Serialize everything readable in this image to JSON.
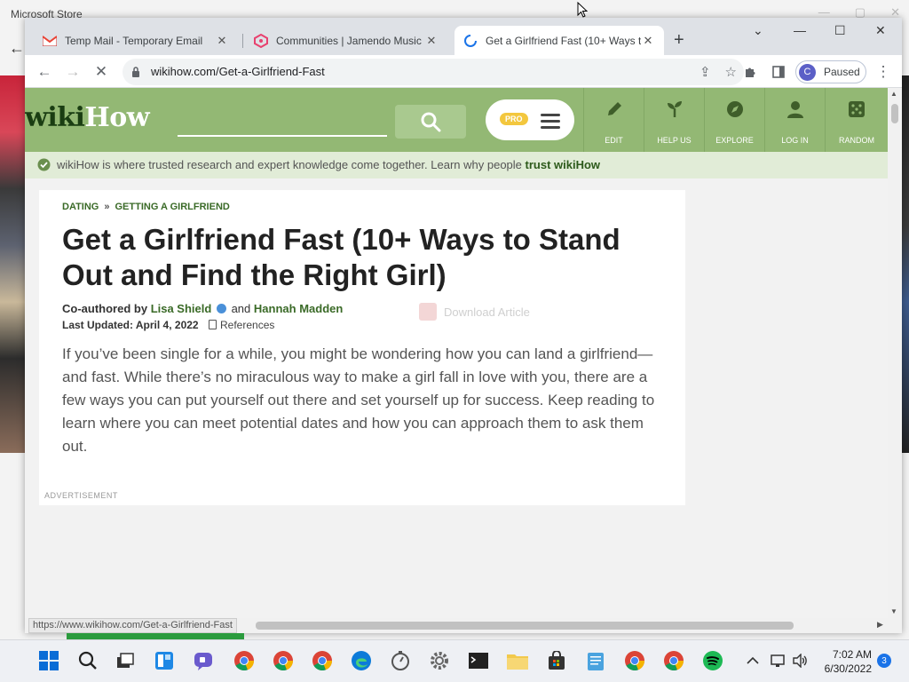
{
  "background_window": {
    "title": "Microsoft Store"
  },
  "tabs": [
    {
      "title": "Temp Mail - Temporary Email",
      "icon": "gmail-icon"
    },
    {
      "title": "Communities | Jamendo Music | F",
      "icon": "jamendo-icon"
    },
    {
      "title": "Get a Girlfriend Fast (10+ Ways t",
      "icon": "loading-spinner-icon"
    }
  ],
  "toolbar": {
    "url": "wikihow.com/Get-a-Girlfriend-Fast",
    "profile_initial": "C",
    "profile_label": "Paused"
  },
  "wikihow": {
    "logo_part1": "wiki",
    "logo_part2": "How",
    "pro_badge": "PRO",
    "nav": [
      {
        "label": "EDIT",
        "icon": "pencil-icon"
      },
      {
        "label": "HELP US",
        "icon": "sprout-icon"
      },
      {
        "label": "EXPLORE",
        "icon": "compass-icon"
      },
      {
        "label": "LOG IN",
        "icon": "user-icon"
      },
      {
        "label": "RANDOM",
        "icon": "dice-icon"
      }
    ],
    "trust_text": "wikiHow is where trusted research and expert knowledge come together. Learn why people ",
    "trust_link": "trust wikiHow"
  },
  "article": {
    "breadcrumb": [
      "DATING",
      "GETTING A GIRLFRIEND"
    ],
    "breadcrumb_sep": "»",
    "title": "Get a Girlfriend Fast (10+ Ways to Stand Out and Find the Right Girl)",
    "coauthored_label": "Co-authored by",
    "author1": "Lisa Shield",
    "and": "and",
    "author2": "Hannah Madden",
    "last_updated": "Last Updated: April 4, 2022",
    "references": "References",
    "download": "Download Article",
    "intro": "If you’ve been single for a while, you might be wondering how you can land a girlfriend—and fast. While there’s no miraculous way to make a girl fall in love with you, there are a few ways you can put yourself out there and set yourself up for success. Keep reading to learn where you can meet potential dates and how you can approach them to ask them out.",
    "ad_label": "ADVERTISEMENT"
  },
  "status_bar": {
    "hover_url": "https://www.wikihow.com/Get-a-Girlfriend-Fast"
  },
  "taskbar": {
    "time": "7:02 AM",
    "date": "6/30/2022",
    "notification_count": "3"
  },
  "colors": {
    "wikihow_green": "#93b874",
    "link_green": "#3a6a27",
    "pro_yellow": "#f3c73e"
  }
}
